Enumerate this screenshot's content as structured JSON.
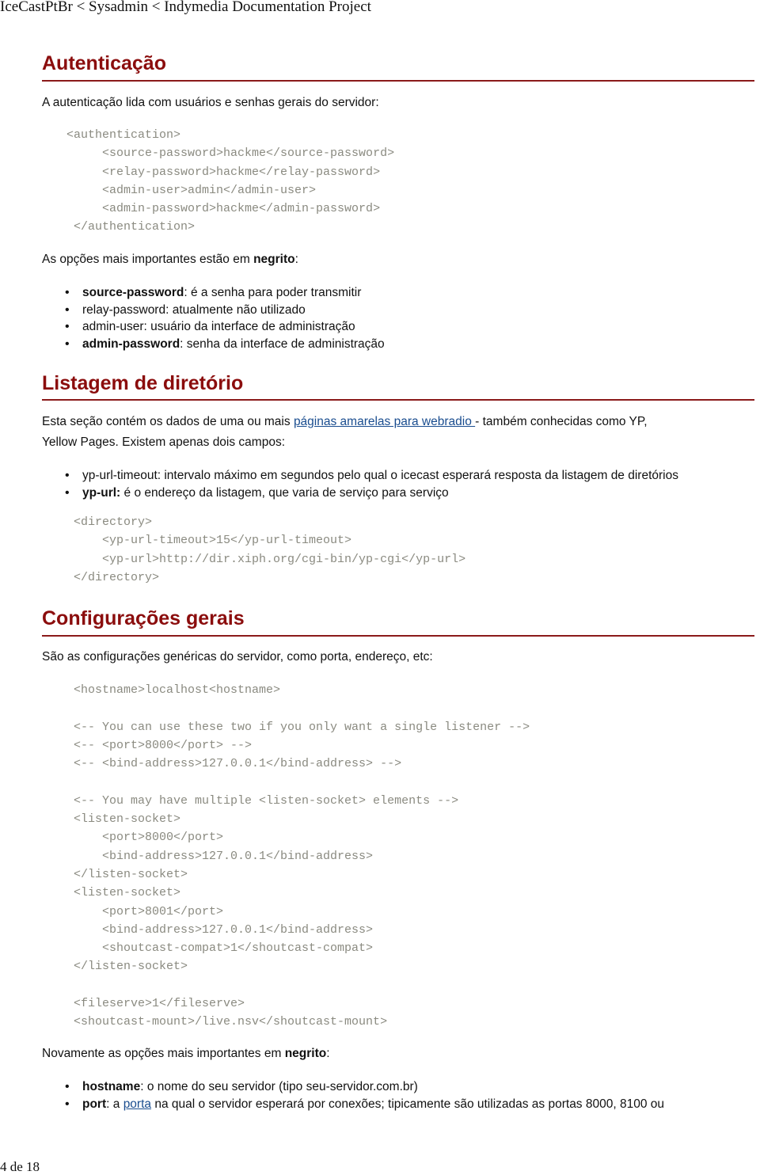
{
  "page_title": "IceCastPtBr < Sysadmin < Indymedia Documentation Project",
  "sections": {
    "auth": {
      "heading": "Autenticação",
      "intro": "A autenticação lida com usuários e senhas gerais do servidor:",
      "code": "<authentication>\n     <source-password>hackme</source-password>\n     <relay-password>hackme</relay-password>\n     <admin-user>admin</admin-user>\n     <admin-password>hackme</admin-password>\n </authentication>",
      "bold_note_prefix": "As opções mais importantes estão em ",
      "bold_note_word": "negrito",
      "bold_note_suffix": ":",
      "items": [
        {
          "key": "source-password",
          "bold": true,
          "text": ": é a senha para poder transmitir"
        },
        {
          "key": "relay-password",
          "bold": false,
          "text": ": atualmente não utilizado"
        },
        {
          "key": "admin-user",
          "bold": false,
          "text": ": usuário da interface de administração"
        },
        {
          "key": "admin-password",
          "bold": true,
          "text": ": senha da interface de administração"
        }
      ]
    },
    "directory": {
      "heading": "Listagem de diretório",
      "intro_prefix": "Esta seção contém os dados de uma ou mais ",
      "intro_link": "páginas amarelas para webradio ",
      "intro_suffix": " - também conhecidas como YP,",
      "intro_line2": "Yellow Pages. Existem apenas dois campos:",
      "items": [
        {
          "key": "yp-url-timeout",
          "bold": false,
          "text": ": intervalo máximo em segundos pelo qual o icecast esperará resposta da listagem de diretórios"
        },
        {
          "key": "yp-url:",
          "bold": true,
          "text": " é o endereço da listagem, que varia de serviço para serviço"
        }
      ],
      "code": "<directory>\n    <yp-url-timeout>15</yp-url-timeout>\n    <yp-url>http://dir.xiph.org/cgi-bin/yp-cgi</yp-url>\n</directory>"
    },
    "general": {
      "heading": "Configurações gerais",
      "intro": "São as configurações genéricas do servidor, como porta, endereço, etc:",
      "code": "<hostname>localhost<hostname>\n\n<-- You can use these two if you only want a single listener -->\n<-- <port>8000</port> -->\n<-- <bind-address>127.0.0.1</bind-address> -->\n\n<-- You may have multiple <listen-socket> elements -->\n<listen-socket>\n    <port>8000</port>\n    <bind-address>127.0.0.1</bind-address>\n</listen-socket>\n<listen-socket>\n    <port>8001</port>\n    <bind-address>127.0.0.1</bind-address>\n    <shoutcast-compat>1</shoutcast-compat>\n</listen-socket>\n\n<fileserve>1</fileserve>\n<shoutcast-mount>/live.nsv</shoutcast-mount>",
      "bold_note_prefix": "Novamente as opções mais importantes em ",
      "bold_note_word": "negrito",
      "bold_note_suffix": ":",
      "items": [
        {
          "key": "hostname",
          "text": ": o nome do seu servidor (tipo seu-servidor.com.br)"
        },
        {
          "key": "port",
          "text_before": ": a ",
          "link": "porta",
          "text_after": " na qual o servidor esperará por conexões; tipicamente são utilizadas as portas 8000, 8100 ou"
        }
      ]
    }
  },
  "footer": {
    "page_indicator": "4 de 18"
  },
  "colors": {
    "heading": "#8b0d0d",
    "rule": "#8b1a1a",
    "code": "#8a8a80",
    "link": "#1a4d8f"
  }
}
